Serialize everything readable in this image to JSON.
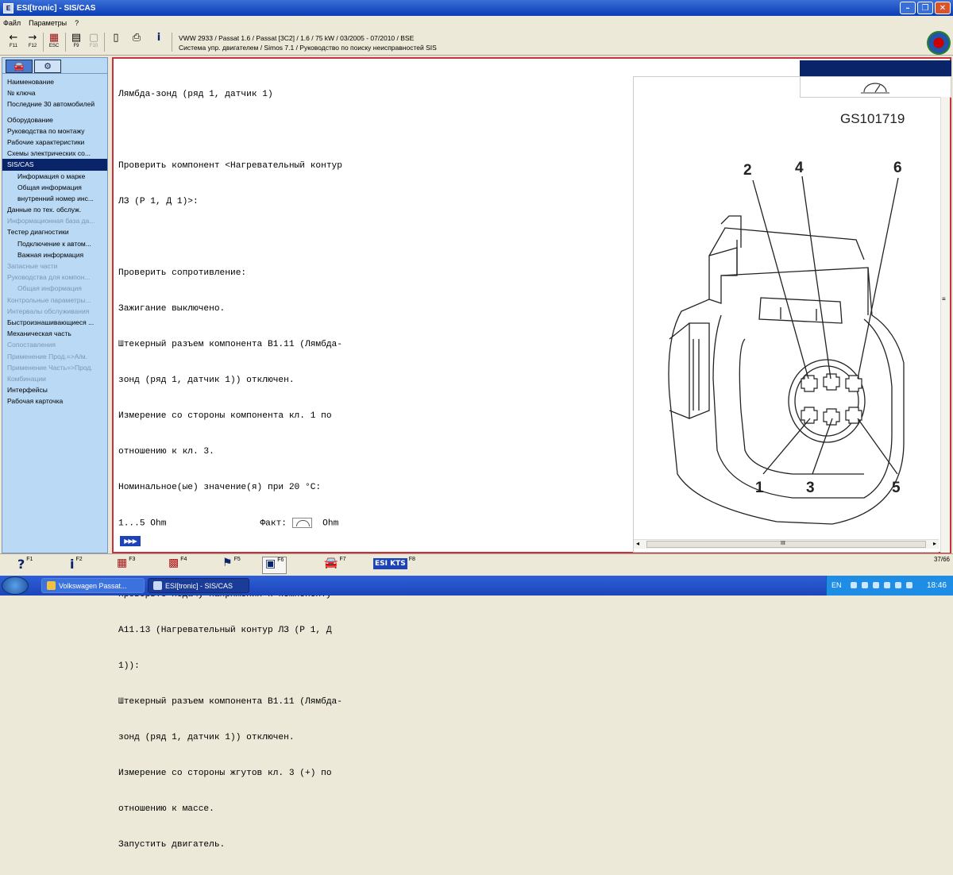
{
  "window": {
    "title": "ESI[tronic] - SIS/CAS",
    "min": "–",
    "max": "❐",
    "close": "✕"
  },
  "menu": [
    "Файл",
    "Параметры",
    "?"
  ],
  "toolbar": {
    "buttons": [
      {
        "glyph": "←",
        "key": "F11",
        "icon": "back-arrow-icon"
      },
      {
        "glyph": "→",
        "key": "F12",
        "icon": "forward-arrow-icon"
      },
      {
        "glyph": "▦",
        "key": "ESC",
        "icon": "exit-icon"
      },
      {
        "glyph": "▤",
        "key": "F9",
        "icon": "f9-icon"
      },
      {
        "glyph": "▢",
        "key": "F10",
        "icon": "f10-icon"
      },
      {
        "glyph": "▯",
        "key": "",
        "icon": "document-icon"
      },
      {
        "glyph": "⎙",
        "key": "",
        "icon": "printer-icon"
      },
      {
        "glyph": "i",
        "key": "",
        "icon": "info-icon"
      }
    ],
    "vehicle_line1": "VWW 2933 / Passat 1.6 / Passat [3C2] / 1.6 / 75 kW / 03/2005 - 07/2010 / BSE",
    "vehicle_line2": "Система упр. двигателем / Simos 7.1 / Руководство по поиску неисправностей SIS"
  },
  "sidebar": {
    "tabs": [
      {
        "glyph": "🚘",
        "icon": "car-tab-icon"
      },
      {
        "glyph": "⚙",
        "icon": "engine-tab-icon"
      }
    ],
    "items": [
      {
        "label": "Наименование",
        "state": "normal"
      },
      {
        "label": "№ ключа",
        "state": "normal"
      },
      {
        "label": "Последние 30 автомобилей",
        "state": "normal"
      },
      {
        "label": "Оборудование",
        "state": "normal",
        "gap": true
      },
      {
        "label": "Руководства по монтажу",
        "state": "normal"
      },
      {
        "label": "Рабочие характеристики",
        "state": "normal"
      },
      {
        "label": "Схемы электрических со...",
        "state": "normal"
      },
      {
        "label": "SIS/CAS",
        "state": "selected"
      },
      {
        "label": "Информация о марке",
        "state": "sub"
      },
      {
        "label": "Общая информация",
        "state": "sub"
      },
      {
        "label": "внутренний номер инс...",
        "state": "sub"
      },
      {
        "label": "Данные по тех. обслуж.",
        "state": "normal"
      },
      {
        "label": "Информационная база да...",
        "state": "disabled"
      },
      {
        "label": "Тестер диагностики",
        "state": "normal"
      },
      {
        "label": "Подключение к автом...",
        "state": "sub"
      },
      {
        "label": "Важная информация",
        "state": "sub"
      },
      {
        "label": "Запасные части",
        "state": "disabled"
      },
      {
        "label": "Руководства для компон...",
        "state": "disabled"
      },
      {
        "label": "Общая информация",
        "state": "subdisabled"
      },
      {
        "label": "Контрольные параметры...",
        "state": "disabled"
      },
      {
        "label": "Интервалы обслуживания",
        "state": "disabled"
      },
      {
        "label": "Быстроизнашивающиеся ...",
        "state": "normal"
      },
      {
        "label": "Механическая часть",
        "state": "normal"
      },
      {
        "label": "Сопоставления",
        "state": "disabled"
      },
      {
        "label": "Применение Прод.=>А/м.",
        "state": "disabled"
      },
      {
        "label": "Применение Часть=>Прод.",
        "state": "disabled"
      },
      {
        "label": "Комбинации",
        "state": "disabled"
      },
      {
        "label": "Интерфейсы",
        "state": "normal"
      },
      {
        "label": "Рабочая карточка",
        "state": "normal"
      }
    ]
  },
  "document": {
    "title": "Лямбда-зонд (ряд 1, датчик 1)",
    "check_component": [
      "Проверить компонент <Нагревательный контур",
      "ЛЗ (Р 1, Д 1)>:"
    ],
    "resistance": [
      "Проверить сопротивление:",
      "Зажигание выключено.",
      "Штекерный разъем компонента B1.11 (Лямбда-",
      "зонд (ряд 1, датчик 1)) отключен.",
      "Измерение со стороны компонента кл. 1 по",
      "отношению к кл. 3.",
      "Номинальное(ые) значение(я) при 20 °C:"
    ],
    "nominal_value": "1...5 Ohm",
    "fact_label": "Факт:",
    "fact_unit": "Ohm",
    "voltage": [
      "Проверьте подачу напряжения к компоненту",
      "A11.13 (Нагревательный контур ЛЗ (Р 1, Д",
      "1)):",
      "Штекерный разъем компонента B1.11 (Лямбда-",
      "зонд (ряд 1, датчик 1)) отключен.",
      "Измерение со стороны жгутов кл. 3 (+) по",
      "отношению к массе.",
      "Запустить двигатель."
    ],
    "next_button": "▶▶▶"
  },
  "figure": {
    "id": "GS101719",
    "pins_top": [
      "2",
      "4",
      "6"
    ],
    "pins_bottom": [
      "1",
      "3",
      "5"
    ],
    "scroll_grip": "III",
    "vscroll_grip": "≡"
  },
  "bottombar": {
    "buttons": [
      {
        "glyph": "?",
        "key": "F1",
        "icon": "help-icon"
      },
      {
        "glyph": "i",
        "key": "F2",
        "icon": "info-icon"
      },
      {
        "glyph": "▦",
        "key": "F3",
        "icon": "components-icon"
      },
      {
        "glyph": "▩",
        "key": "F4",
        "icon": "wiring-icon"
      },
      {
        "glyph": "⚑",
        "key": "F5",
        "icon": "component-test-icon"
      },
      {
        "glyph": "▣",
        "key": "F6",
        "icon": "measurement-icon"
      },
      {
        "glyph": "🚘",
        "key": "F7",
        "icon": "vehicle-icon"
      },
      {
        "glyph": "ESI KTS",
        "key": "F8",
        "icon": "esi-kts-icon"
      }
    ],
    "page_count": "37/66"
  },
  "taskbar": {
    "tasks": [
      "Volkswagen Passat...",
      "ESI[tronic] - SIS/CAS"
    ],
    "lang": "EN",
    "clock": "18:46"
  }
}
